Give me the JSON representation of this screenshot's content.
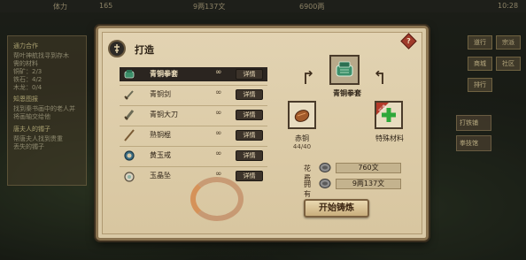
{
  "topbar": {
    "power_label": "体力",
    "power_value": "165",
    "money_value": "9两137文",
    "gold_value": "6900两",
    "time": "10:28"
  },
  "quests": [
    {
      "title": "通力合作",
      "lines": [
        "帮叶神航找寻到存木",
        "需的材料",
        "铜矿：2/3",
        "铁石：4/2",
        "木龙：0/4"
      ]
    },
    {
      "title": "知恩图报",
      "lines": [
        "找到秦书画中的老人并",
        "将画轴交给他"
      ]
    },
    {
      "title": "唐夫人的镯子",
      "lines": [
        "帮唐夫人找到贵重",
        "丢失的镯子"
      ]
    }
  ],
  "right_menu": [
    "道行",
    "宗派",
    "商城",
    "社区",
    "排行"
  ],
  "side_buttons": [
    "打铁铺",
    "拳技馆"
  ],
  "dialog": {
    "title": "打造",
    "help_symbol": "?",
    "items": [
      {
        "name": "青铜拳套",
        "count": "∞",
        "detail": "详情",
        "icon": "gauntlet-icon",
        "selected": true
      },
      {
        "name": "青铜剑",
        "count": "∞",
        "detail": "详情",
        "icon": "sword-icon",
        "selected": false
      },
      {
        "name": "青铜大刀",
        "count": "∞",
        "detail": "详情",
        "icon": "broadsword-icon",
        "selected": false
      },
      {
        "name": "熟铜棍",
        "count": "∞",
        "detail": "详情",
        "icon": "staff-icon",
        "selected": false
      },
      {
        "name": "黄玉戒",
        "count": "∞",
        "detail": "详情",
        "icon": "ring-icon",
        "selected": false
      },
      {
        "name": "玉晶坠",
        "count": "∞",
        "detail": "详情",
        "icon": "pendant-icon",
        "selected": false
      }
    ],
    "target": {
      "name": "青铜拳套",
      "icon": "gauntlet-icon"
    },
    "materials": [
      {
        "name": "赤铜",
        "count": "44/40",
        "icon": "copper-ore-icon"
      },
      {
        "name": "特殊材料",
        "count": "",
        "icon": "plus-icon",
        "tag": "可选"
      }
    ],
    "cost": {
      "label": "花费",
      "value": "760文"
    },
    "owned": {
      "label": "拥有",
      "value": "9两137文"
    },
    "start_button": "开始铸炼"
  },
  "colors": {
    "panel": "#d9c9a6",
    "selected_row": "#2b2520",
    "plus_green": "#2fa83a",
    "help_red": "#a03a2a"
  }
}
